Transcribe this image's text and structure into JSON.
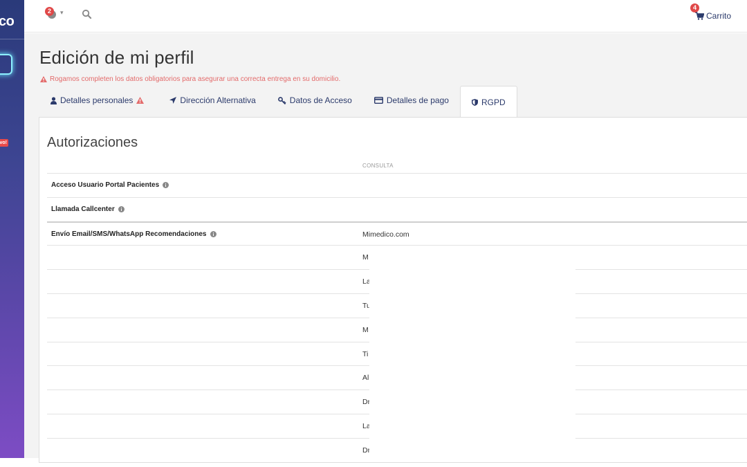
{
  "sidebar": {
    "logo_text": "co",
    "badge_new": "vo!"
  },
  "topbar": {
    "notifications_count": "2",
    "cart_count": "4",
    "cart_label": "Carrito"
  },
  "page": {
    "title": "Edición de mi perfil",
    "warning": "Rogamos completen los datos obligatorios para asegurar una correcta entrega en su domicilio."
  },
  "tabs": [
    {
      "label": "Detalles personales",
      "icon": "user-icon"
    },
    {
      "label": "Dirección Alternativa",
      "icon": "location-arrow-icon"
    },
    {
      "label": "Datos de Acceso",
      "icon": "key-icon"
    },
    {
      "label": "Detalles de pago",
      "icon": "credit-card-icon"
    },
    {
      "label": "RGPD",
      "icon": "shield-icon",
      "active": true
    }
  ],
  "panel": {
    "section_title": "Autorizaciones",
    "column_header": "CONSULTA",
    "rows": [
      {
        "label": "Acceso Usuario Portal Pacientes",
        "value": ""
      },
      {
        "label": "Llamada Callcenter",
        "value": ""
      },
      {
        "label": "Envío Email/SMS/WhatsApp Recomendaciones",
        "value": "Mimedico.com"
      },
      {
        "label": "",
        "value": "M"
      },
      {
        "label": "",
        "value": "La"
      },
      {
        "label": "",
        "value": "Tu"
      },
      {
        "label": "",
        "value": "M"
      },
      {
        "label": "",
        "value": "Ti"
      },
      {
        "label": "",
        "value": "Al"
      },
      {
        "label": "",
        "value": "Dr"
      },
      {
        "label": "",
        "value": "La"
      },
      {
        "label": "",
        "value": "Dr"
      }
    ]
  },
  "colors": {
    "accent": "#2b3a6b",
    "warning": "#e36b6b",
    "badge": "#e04848"
  }
}
